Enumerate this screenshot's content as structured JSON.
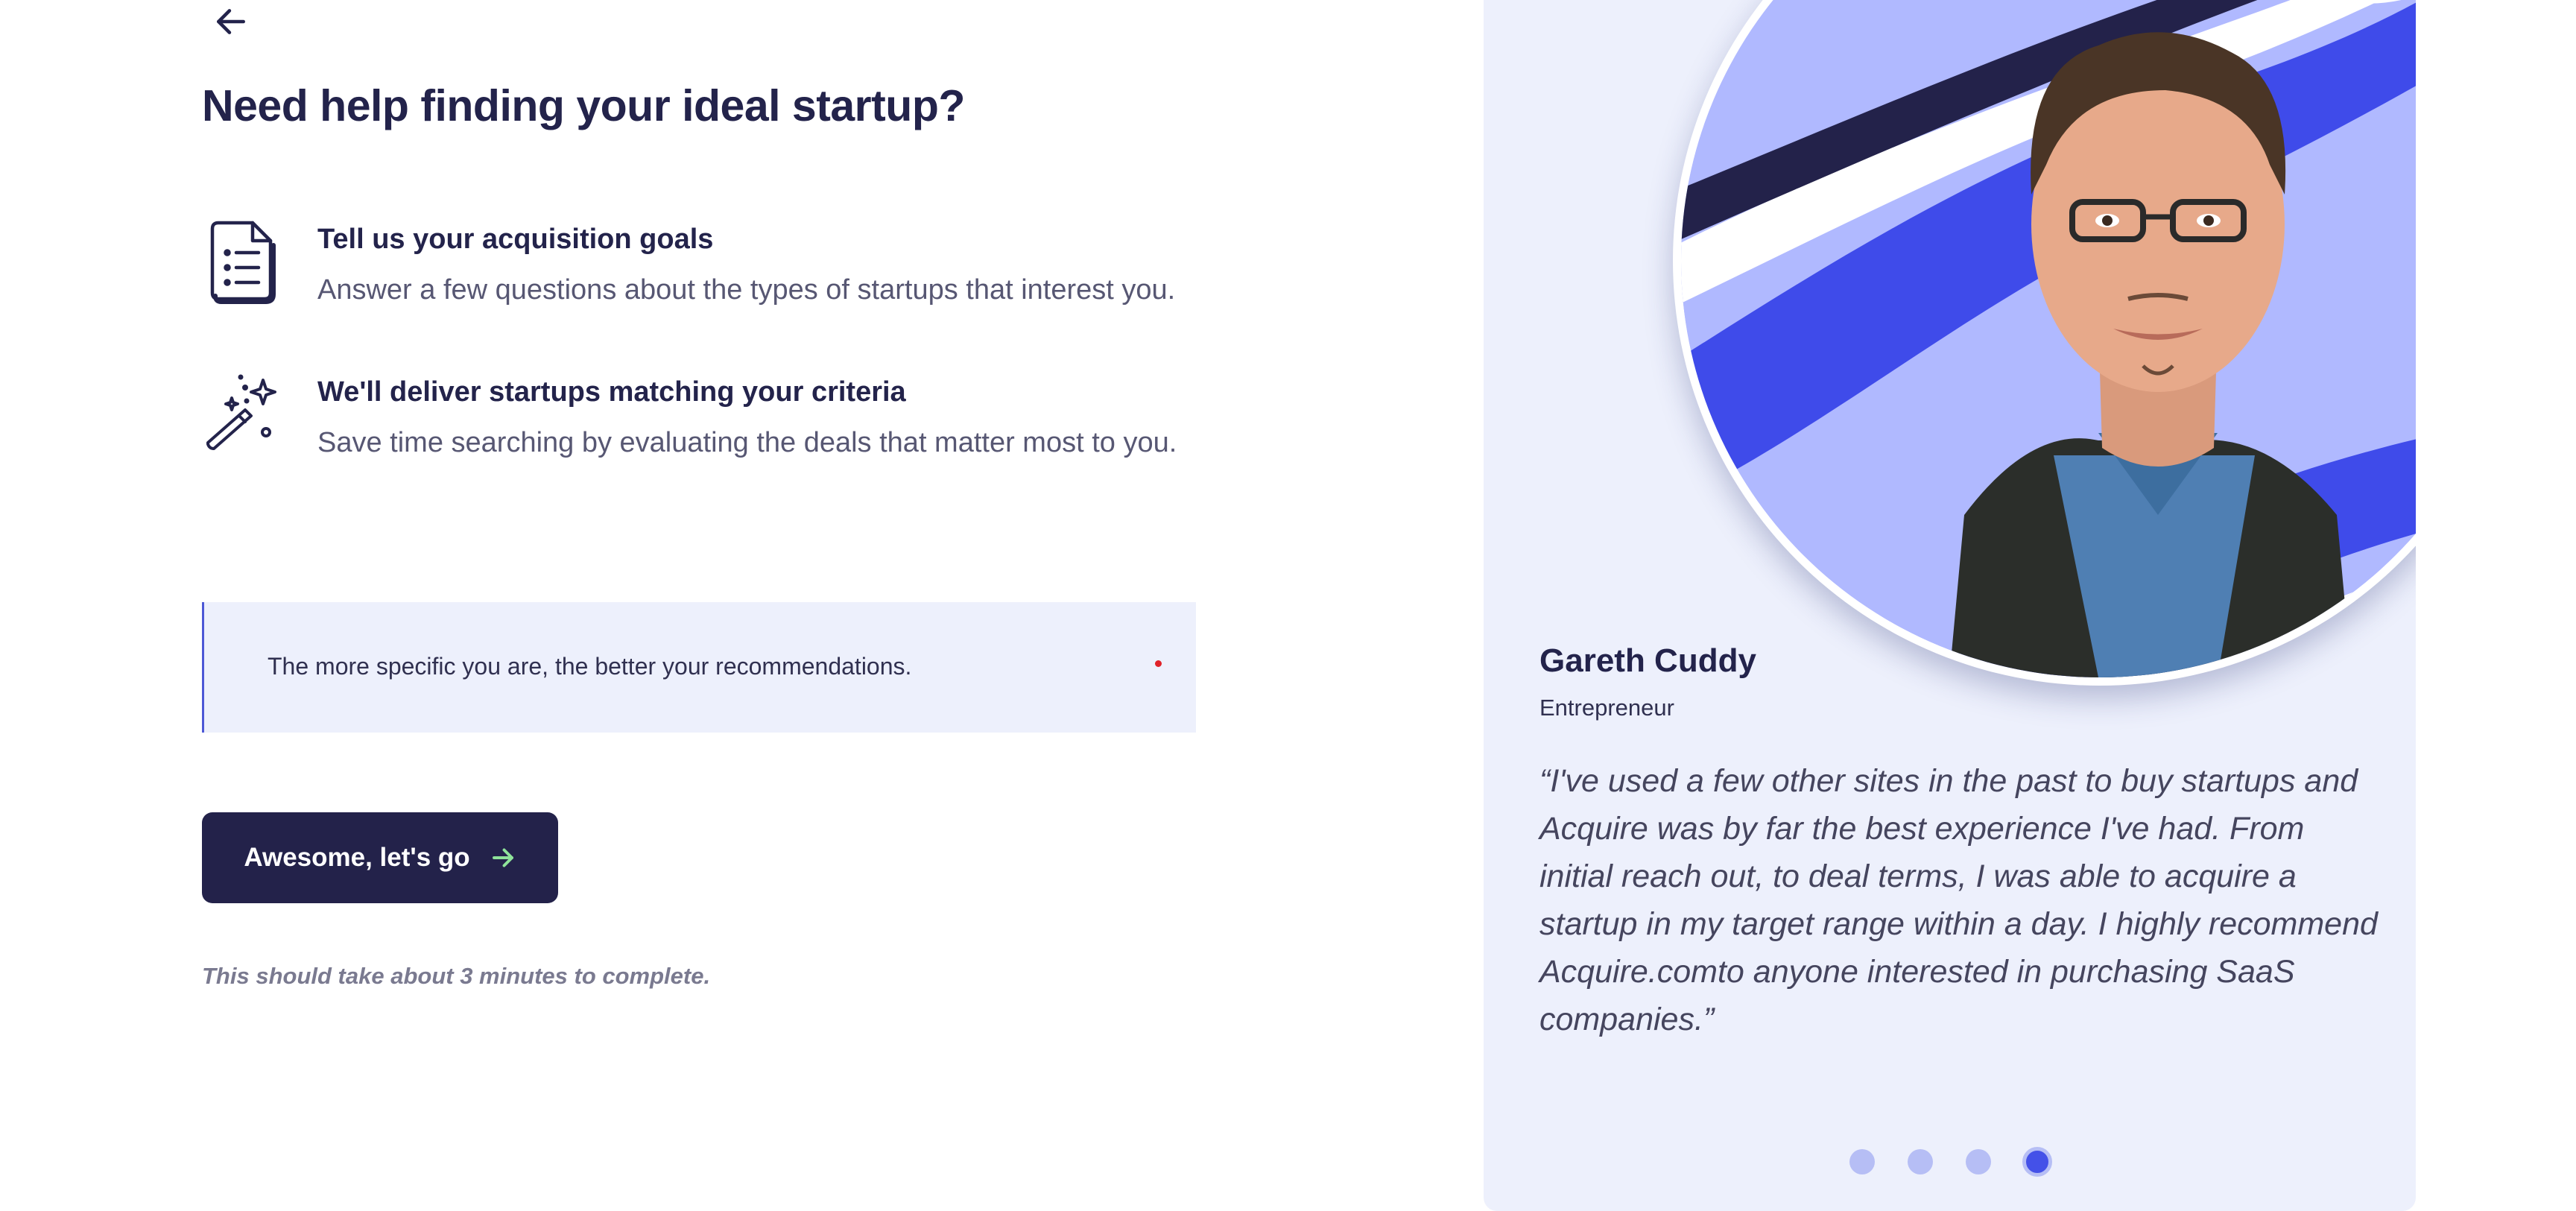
{
  "header": {
    "title": "Need help finding your ideal startup?"
  },
  "steps": [
    {
      "icon": "document-list-icon",
      "title": "Tell us your acquisition goals",
      "description": "Answer a few questions about the types of startups that interest you."
    },
    {
      "icon": "magic-wand-icon",
      "title": "We'll deliver startups matching your criteria",
      "description": "Save time searching by evaluating the deals that matter most to you."
    }
  ],
  "tip": {
    "text": "The more specific you are, the better your recommendations."
  },
  "cta": {
    "label": "Awesome, let's go"
  },
  "note": {
    "text": "This should take about 3 minutes to complete."
  },
  "testimonial": {
    "name": "Gareth Cuddy",
    "role": "Entrepreneur",
    "quote": "“I've used a few other sites in the past to buy startups and Acquire was by far the best experience I've had. From initial reach out, to deal terms, I was able to acquire a startup in my target range within a day. I highly recommend Acquire.comto anyone interested in purchasing SaaS companies.”",
    "dots_total": 4,
    "active_dot": 4
  },
  "colors": {
    "navy": "#23224a",
    "card_bg": "#edf0fc",
    "accent_blue": "#4451e8",
    "arrow_green": "#8fe39a"
  }
}
